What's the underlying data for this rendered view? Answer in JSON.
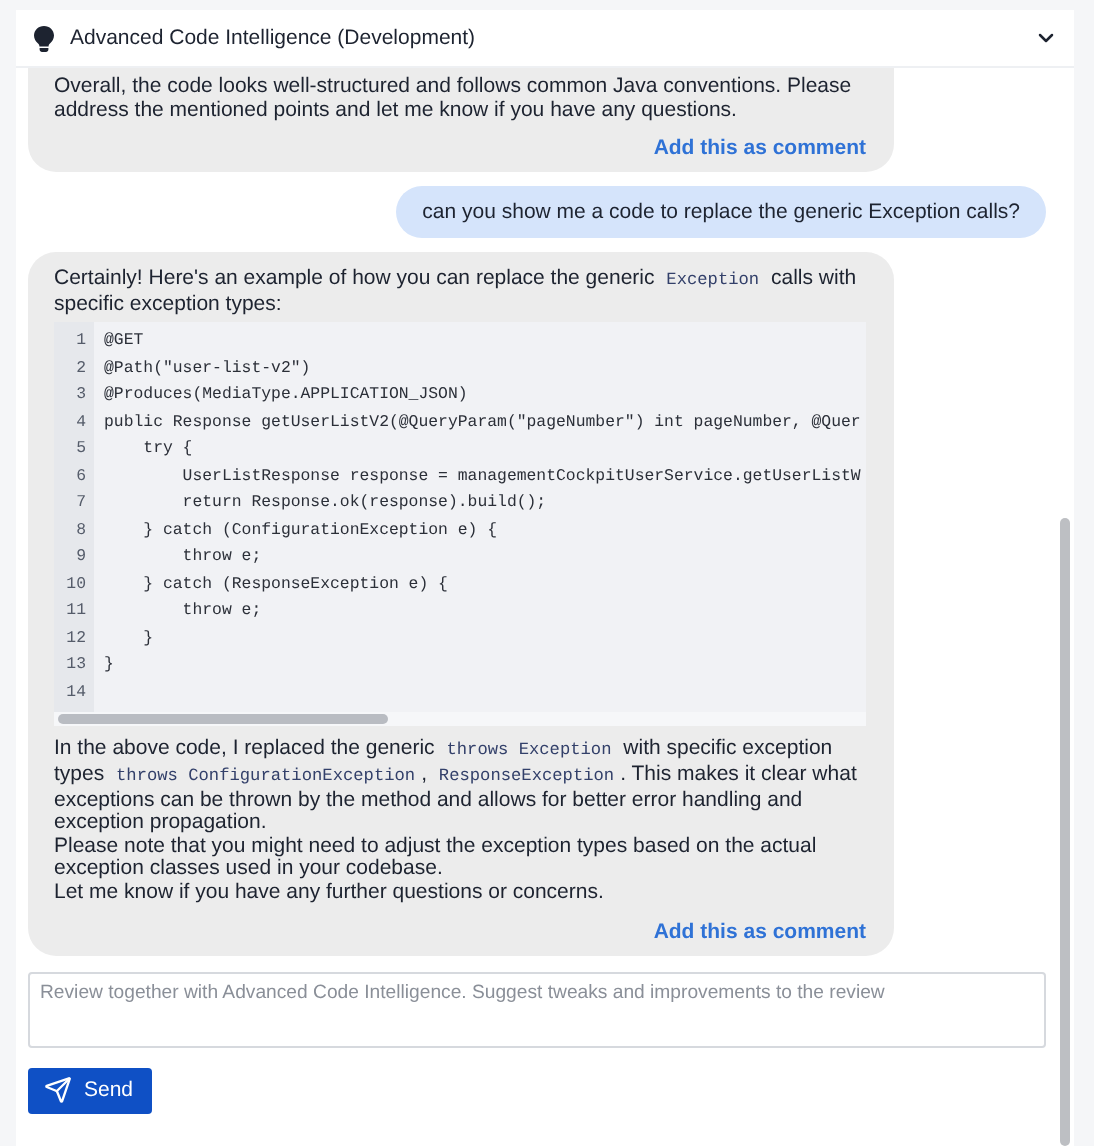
{
  "header": {
    "title": "Advanced Code Intelligence (Development)"
  },
  "messages": [
    {
      "kind": "assistant",
      "blocks": [
        {
          "kind": "text",
          "segments": [
            {
              "text": "Overall, the code looks well-structured and follows common Java conventions. Please address the mentioned points and let me know if you have any questions.",
              "kind": "plain"
            }
          ]
        }
      ],
      "action": "Add this as comment"
    },
    {
      "kind": "user",
      "text": "can you show me a code to replace the generic Exception calls?"
    },
    {
      "kind": "assistant",
      "blocks": [
        {
          "kind": "text",
          "segments": [
            {
              "text": "Certainly! Here's an example of how you can replace the generic ",
              "kind": "plain"
            },
            {
              "text": "Exception",
              "kind": "code"
            },
            {
              "text": " calls with specific exception types:",
              "kind": "plain"
            }
          ]
        },
        {
          "kind": "code",
          "lines": [
            {
              "number": "1",
              "code": "@GET"
            },
            {
              "number": "2",
              "code": "@Path(\"user-list-v2\")"
            },
            {
              "number": "3",
              "code": "@Produces(MediaType.APPLICATION_JSON)"
            },
            {
              "number": "4",
              "code": "public Response getUserListV2(@QueryParam(\"pageNumber\") int pageNumber, @Quer"
            },
            {
              "number": "5",
              "code": "    try {"
            },
            {
              "number": "6",
              "code": "        UserListResponse response = managementCockpitUserService.getUserListW"
            },
            {
              "number": "7",
              "code": "        return Response.ok(response).build();"
            },
            {
              "number": "8",
              "code": "    } catch (ConfigurationException e) {"
            },
            {
              "number": "9",
              "code": "        throw e;"
            },
            {
              "number": "10",
              "code": "    } catch (ResponseException e) {"
            },
            {
              "number": "11",
              "code": "        throw e;"
            },
            {
              "number": "12",
              "code": "    }"
            },
            {
              "number": "13",
              "code": "}"
            },
            {
              "number": "14"
            }
          ]
        },
        {
          "kind": "text",
          "segments": [
            {
              "text": "In the above code, I replaced the generic ",
              "kind": "plain"
            },
            {
              "text": "throws Exception",
              "kind": "code"
            },
            {
              "text": " with specific exception types ",
              "kind": "plain"
            },
            {
              "text": "throws ConfigurationException",
              "kind": "code"
            },
            {
              "text": ", ",
              "kind": "plain"
            },
            {
              "text": "ResponseException",
              "kind": "code"
            },
            {
              "text": ". This makes it clear what exceptions can be thrown by the method and allows for better error handling and exception propagation.",
              "kind": "plain"
            }
          ]
        },
        {
          "kind": "text",
          "segments": [
            {
              "text": "Please note that you might need to adjust the exception types based on the actual exception classes used in your codebase.",
              "kind": "plain"
            }
          ]
        },
        {
          "kind": "text",
          "segments": [
            {
              "text": "Let me know if you have any further questions or concerns.",
              "kind": "plain"
            }
          ]
        }
      ],
      "action": "Add this as comment"
    }
  ],
  "composer": {
    "placeholder": "Review together with Advanced Code Intelligence. Suggest tweaks and improvements to the review",
    "send": "Send"
  }
}
